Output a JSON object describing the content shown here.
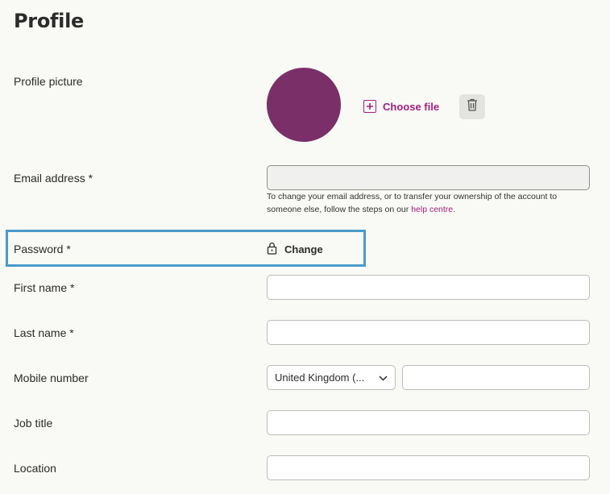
{
  "page": {
    "title": "Profile"
  },
  "profile_picture": {
    "label": "Profile picture",
    "choose_file_label": "Choose file",
    "avatar_color": "#7b2f68",
    "delete_icon": "trash-icon"
  },
  "email": {
    "label": "Email address *",
    "value": "",
    "helper_text": "To change your email address, or to transfer your ownership of the account to someone else, follow the steps on our ",
    "help_link": "help centre",
    "helper_suffix": "."
  },
  "password": {
    "label": "Password *",
    "change_label": "Change",
    "icon": "lock-icon"
  },
  "first_name": {
    "label": "First name *",
    "value": ""
  },
  "last_name": {
    "label": "Last name *",
    "value": ""
  },
  "mobile": {
    "label": "Mobile number",
    "country_selected": "United Kingdom (...",
    "value": ""
  },
  "job_title": {
    "label": "Job title",
    "value": ""
  },
  "location": {
    "label": "Location",
    "value": ""
  },
  "colors": {
    "accent": "#a3207f",
    "highlight": "#4a9bcb",
    "background": "#f9f9f5"
  }
}
